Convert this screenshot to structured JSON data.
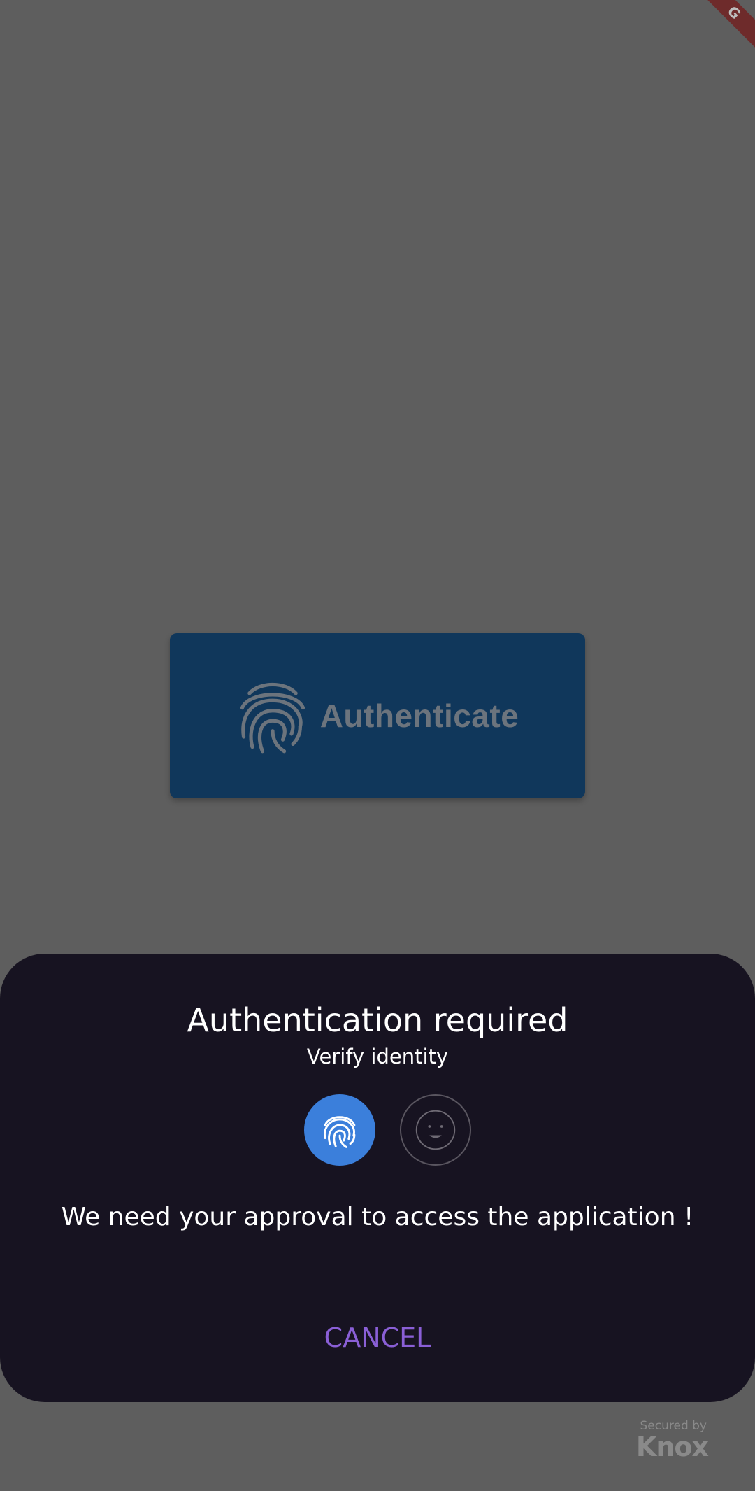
{
  "debug_banner": {
    "label": "G"
  },
  "background_button": {
    "label": "Authenticate",
    "icon": "fingerprint-icon"
  },
  "dialog": {
    "title": "Authentication required",
    "subtitle": "Verify identity",
    "options": [
      {
        "name": "fingerprint",
        "icon": "fingerprint-icon",
        "selected": true
      },
      {
        "name": "face",
        "icon": "face-icon",
        "selected": false
      }
    ],
    "message": "We need your approval to access the application !",
    "cancel_label": "CANCEL"
  },
  "watermark": {
    "secured_by": "Secured by",
    "brand": "Knox"
  },
  "colors": {
    "scrim": "#5e5e5e",
    "button_bg": "#10375b",
    "sheet_bg": "#171321",
    "accent_blue": "#3b7fdb",
    "cancel": "#8a5fd6"
  }
}
